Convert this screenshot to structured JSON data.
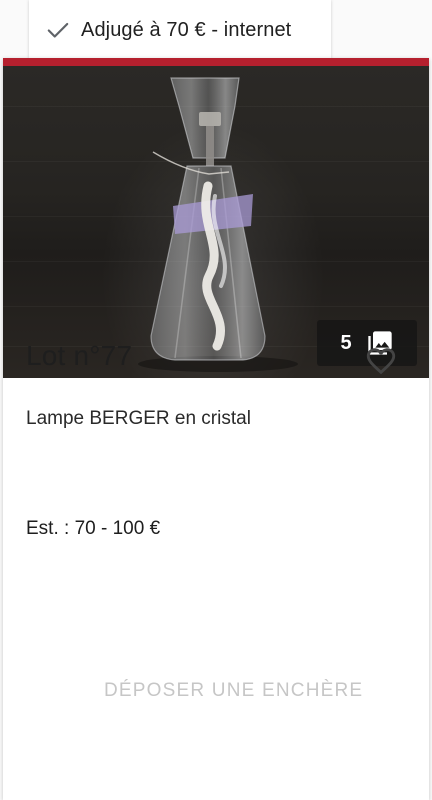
{
  "sold_tab": {
    "text": "Adjugé à 70 € - internet"
  },
  "colors": {
    "accent": "#b5202e",
    "disabled_text": "#c6c6c6"
  },
  "photo": {
    "count": "5",
    "icons": [
      "checkmark-icon",
      "photo-library-icon",
      "heart-outline-icon"
    ]
  },
  "lot": {
    "title": "Lot n°77",
    "description": "Lampe BERGER en cristal",
    "estimate": "Est. : 70 - 100 €"
  },
  "actions": {
    "bid_label": "DÉPOSER UNE ENCHÈRE"
  }
}
